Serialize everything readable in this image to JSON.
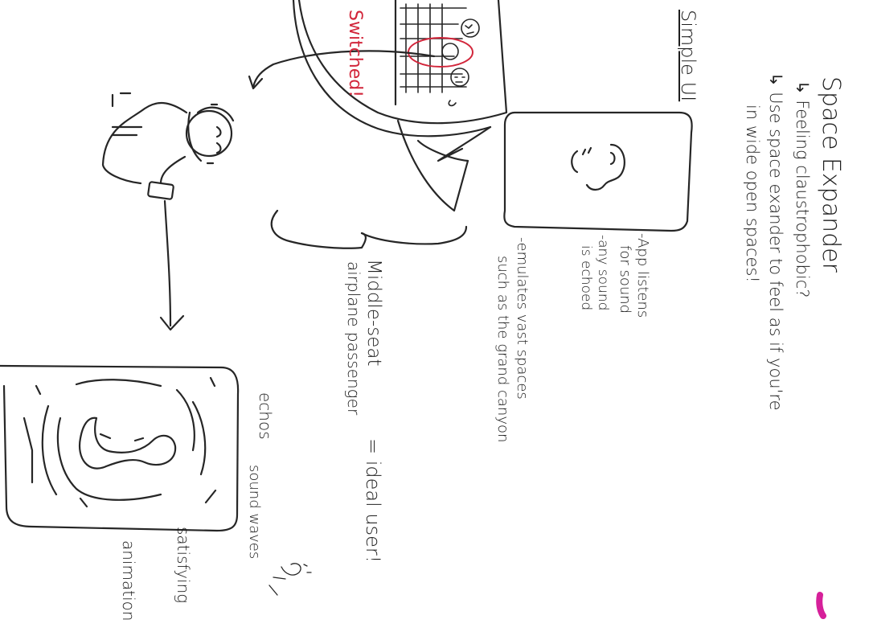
{
  "title": "Space Expander",
  "intro": {
    "line1": "↳ Feeling claustrophobic?",
    "line2": "↳ Use space exander to feel as if you're",
    "line3": "in wide open spaces!"
  },
  "simple_ui": {
    "heading": "Simple UI"
  },
  "features": {
    "f1a": "-App listens",
    "f1b": "for sound",
    "f2a": "-any sound",
    "f2b": "is echoed",
    "f3a": "-emulates vast spaces",
    "f3b": "such as the grand canyon"
  },
  "ideal_user": {
    "line1": "Middle-seat",
    "line2": "airplane passenger",
    "line3": "= ideal user!"
  },
  "screen2": {
    "echos": "echos",
    "sound_waves": "sound waves",
    "satisfying": "satisfying",
    "animation": "animation"
  },
  "plane_scene": {
    "switched": "Switched!"
  },
  "colors": {
    "ink": "#1e1e1e",
    "red_ink": "#d2263b",
    "magenta_mark": "#d6209a"
  }
}
